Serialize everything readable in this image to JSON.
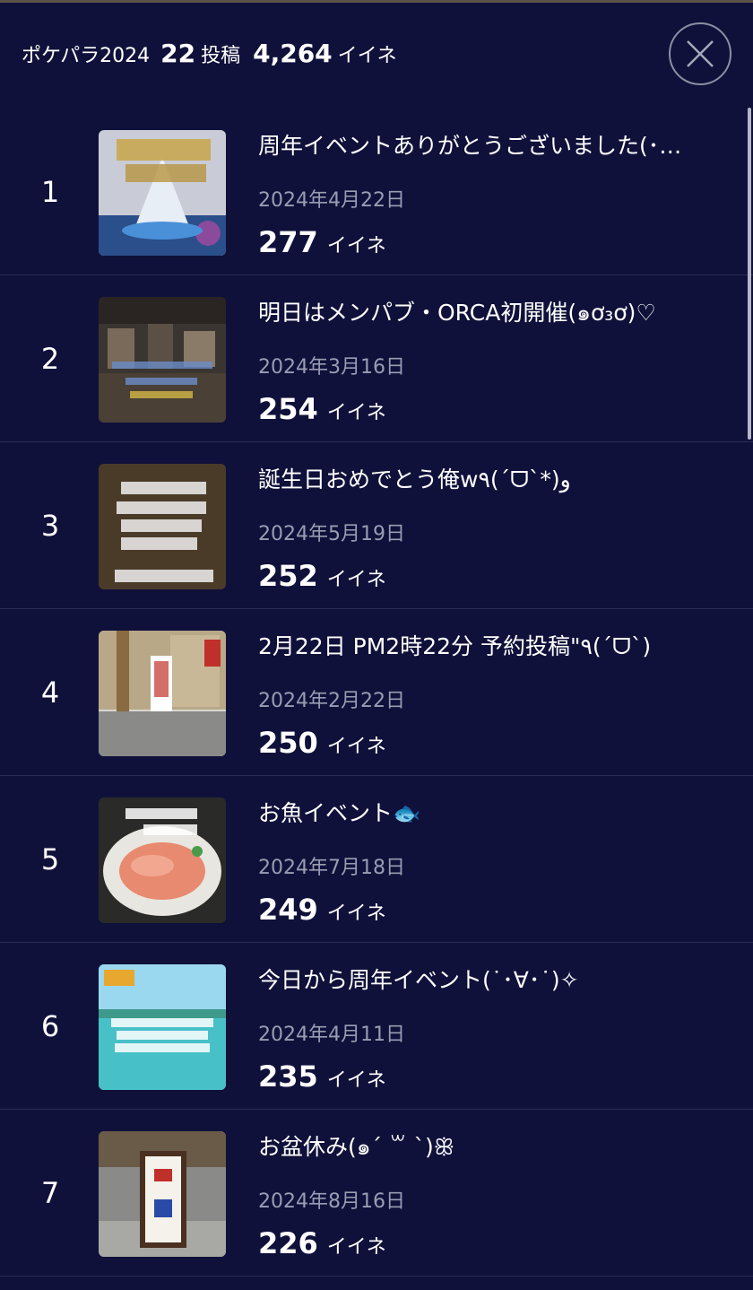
{
  "header": {
    "title": "ポケパラ2024",
    "posts_count": "22",
    "posts_label": "投稿",
    "likes_total": "4,264",
    "likes_label": "イイネ"
  },
  "posts": [
    {
      "rank": "1",
      "title": "周年イベントありがとうございました(･…",
      "date": "2024年4月22日",
      "likes": "277",
      "likes_label": "イイネ",
      "thumb": "anniversary-cake-photo"
    },
    {
      "rank": "2",
      "title": "明日はメンパブ・ORCA初開催(๑ơ₃ơ)♡",
      "date": "2024年3月16日",
      "likes": "254",
      "likes_label": "イイネ",
      "thumb": "bar-interior-photo"
    },
    {
      "rank": "3",
      "title": "誕生日おめでとう俺w٩(ˊᗜˋ*)و",
      "date": "2024年5月19日",
      "likes": "252",
      "likes_label": "イイネ",
      "thumb": "recruit-poster-photo"
    },
    {
      "rank": "4",
      "title": "2月22日 PM2時22分 予約投稿\"٩(ˊᗜˋ)",
      "date": "2024年2月22日",
      "likes": "250",
      "likes_label": "イイネ",
      "thumb": "shop-entrance-photo"
    },
    {
      "rank": "5",
      "title": "お魚イベント🐟",
      "date": "2024年7月18日",
      "likes": "249",
      "likes_label": "イイネ",
      "thumb": "fish-plate-photo"
    },
    {
      "rank": "6",
      "title": "今日から周年イベント(˙･∀･˙)✧",
      "date": "2024年4月11日",
      "likes": "235",
      "likes_label": "イイネ",
      "thumb": "beach-flyer-photo"
    },
    {
      "rank": "7",
      "title": "お盆休み(๑ˊ ꒳ ˋ)ꕥ",
      "date": "2024年8月16日",
      "likes": "226",
      "likes_label": "イイネ",
      "thumb": "street-sign-photo"
    }
  ]
}
